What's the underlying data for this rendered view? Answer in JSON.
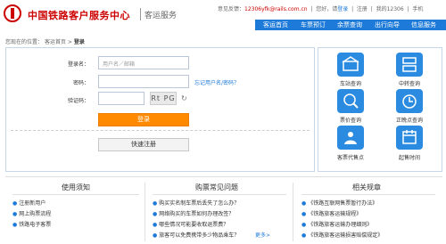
{
  "header": {
    "site_name": "中国铁路客户服务中心",
    "sub_name": "客运服务",
    "feedback_label": "意见反馈：",
    "feedback_email": "12306yfk@rails.com.cn",
    "greeting": "您好，请",
    "login_link": "登录",
    "register_link": "注册",
    "my12306": "我的12306",
    "mobile": "手机"
  },
  "nav": {
    "items": [
      "客运首页",
      "车票预订",
      "余票查询",
      "出行向导",
      "信息服务"
    ]
  },
  "breadcrumb": {
    "prefix": "您现在的位置：",
    "home": "客运首页",
    "arrow": ">",
    "current": "登录"
  },
  "login": {
    "username_label": "登录名：",
    "username_placeholder": "用户名／邮箱",
    "password_label": "密码：",
    "captcha_label": "验证码：",
    "captcha_text": "Rt PG",
    "forgot_link": "忘记用户名/密码？",
    "login_button": "登录",
    "register_button": "快速注册"
  },
  "services": {
    "items": [
      {
        "label": "车站查询",
        "icon": "station-icon"
      },
      {
        "label": "中转查询",
        "icon": "transfer-icon"
      },
      {
        "label": "票价查询",
        "icon": "price-icon"
      },
      {
        "label": "正晚点查询",
        "icon": "delay-icon"
      },
      {
        "label": "客票代售点",
        "icon": "agency-icon"
      },
      {
        "label": "起售时间",
        "icon": "time-icon"
      }
    ]
  },
  "bottom": {
    "col1": {
      "title": "使用须知",
      "items": [
        "注册新用户",
        "网上购票流程",
        "铁路电子客票"
      ]
    },
    "col2": {
      "title": "购票常见问题",
      "items": [
        "购买实名制车票后丢失了怎么办？",
        "网络购买的车票如何办理改签？",
        "哪些情况可能要收取退票费？",
        "旅客可以免费携带多少物品乘车？"
      ],
      "more": "更多>"
    },
    "col3": {
      "title": "相关规章",
      "items": [
        "《铁路互联网售票暂行办法》",
        "《铁路旅客运输规程》",
        "《铁路旅客运输办理细则》",
        "《铁路旅客运输损害赔偿规定》"
      ]
    }
  }
}
